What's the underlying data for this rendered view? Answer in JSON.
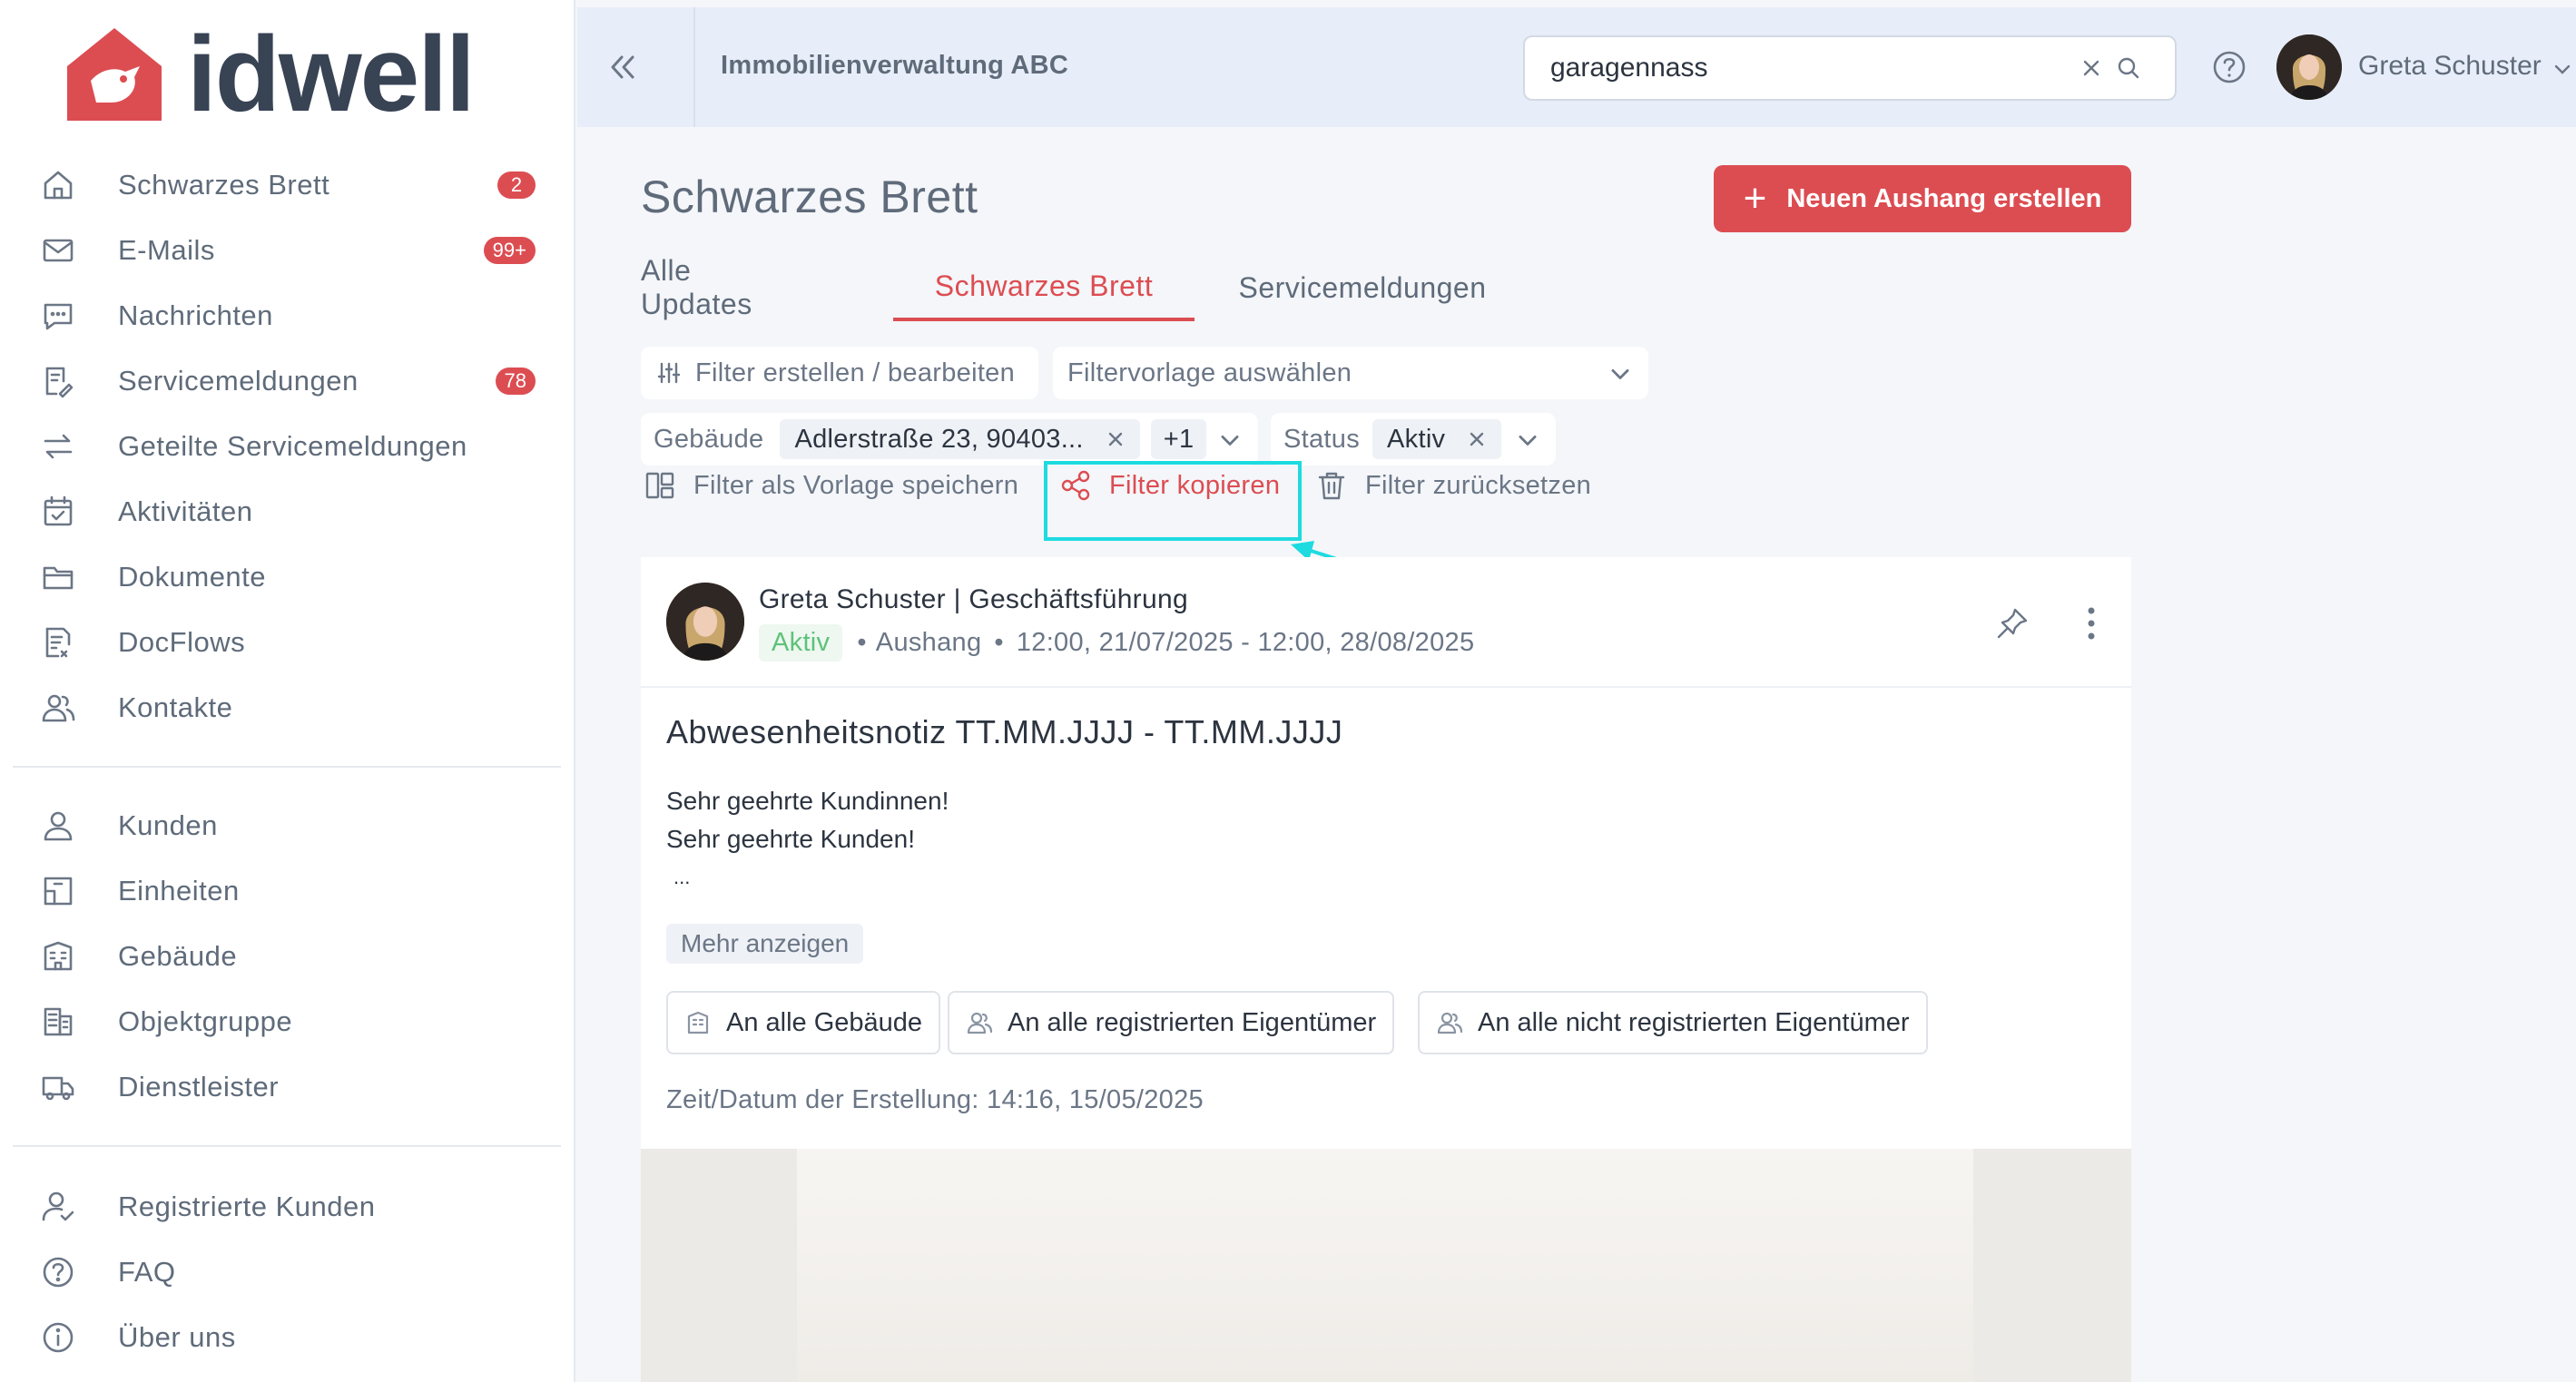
{
  "brand": {
    "name": "idwell",
    "logo_color": "#dc4d52"
  },
  "sidebar": {
    "primary": [
      {
        "label": "Schwarzes Brett",
        "icon": "home-icon",
        "badge": "2"
      },
      {
        "label": "E-Mails",
        "icon": "mail-icon",
        "badge": "99+"
      },
      {
        "label": "Nachrichten",
        "icon": "chat-icon",
        "badge": ""
      },
      {
        "label": "Servicemeldungen",
        "icon": "service-icon",
        "badge": "78"
      },
      {
        "label": "Geteilte Servicemeldungen",
        "icon": "swap-icon",
        "badge": ""
      },
      {
        "label": "Aktivitäten",
        "icon": "calendar-icon",
        "badge": ""
      },
      {
        "label": "Dokumente",
        "icon": "folder-icon",
        "badge": ""
      },
      {
        "label": "DocFlows",
        "icon": "docflow-icon",
        "badge": ""
      },
      {
        "label": "Kontakte",
        "icon": "contacts-icon",
        "badge": ""
      }
    ],
    "secondary": [
      {
        "label": "Kunden",
        "icon": "user-icon"
      },
      {
        "label": "Einheiten",
        "icon": "unit-icon"
      },
      {
        "label": "Gebäude",
        "icon": "building-icon"
      },
      {
        "label": "Objektgruppe",
        "icon": "object-group-icon"
      },
      {
        "label": "Dienstleister",
        "icon": "truck-icon"
      }
    ],
    "tertiary": [
      {
        "label": "Registrierte Kunden",
        "icon": "registered-user-icon"
      },
      {
        "label": "FAQ",
        "icon": "question-icon"
      },
      {
        "label": "Über uns",
        "icon": "info-icon"
      }
    ]
  },
  "header": {
    "company": "Immobilienverwaltung ABC",
    "search_value": "garagennass",
    "user_name": "Greta Schuster"
  },
  "main": {
    "title": "Schwarzes Brett",
    "new_button": "Neuen Aushang erstellen",
    "tabs": [
      "Alle Updates",
      "Schwarzes Brett",
      "Servicemeldungen"
    ],
    "active_tab": "Schwarzes Brett",
    "filter_edit": "Filter erstellen / bearbeiten",
    "filter_template_placeholder": "Filtervorlage auswählen",
    "building_filter": {
      "label": "Gebäude",
      "value": "Adlerstraße 23, 90403...",
      "more": "+1"
    },
    "status_filter": {
      "label": "Status",
      "value": "Aktiv"
    },
    "actions": {
      "save_template": "Filter als Vorlage speichern",
      "copy_filter": "Filter kopieren",
      "reset_filter": "Filter zurücksetzen"
    }
  },
  "post": {
    "author": "Greta Schuster | Geschäftsführung",
    "status": "Aktiv",
    "type": "Aushang",
    "period": "12:00, 21/07/2025 - 12:00, 28/08/2025",
    "title": "Abwesenheitsnotiz TT.MM.JJJJ - TT.MM.JJJJ",
    "body_line1": "Sehr geehrte Kundinnen!",
    "body_line2": "Sehr geehrte Kunden!",
    "body_line3": "...",
    "show_more": "Mehr anzeigen",
    "audiences": [
      "An alle Gebäude",
      "An alle registrierten Eigentümer",
      "An alle nicht registrierten Eigentümer"
    ],
    "created": "Zeit/Datum der Erstellung: 14:16, 15/05/2025"
  },
  "colors": {
    "accent": "#dc4d52",
    "highlight": "#1ddbe0",
    "active_status": "#5ec27a"
  }
}
